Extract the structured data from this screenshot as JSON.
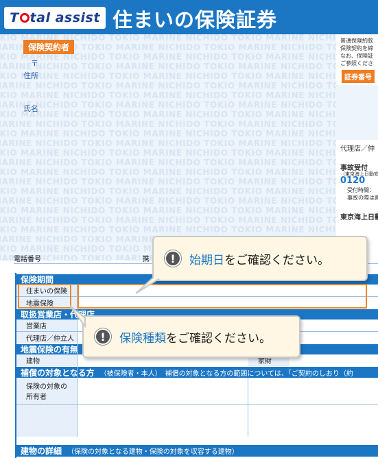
{
  "header": {
    "logo_prefix": "T",
    "logo_suffix": "tal assist",
    "title": "住まいの保険証券"
  },
  "pattern": {
    "text": "TOKIO MARINE NICHIDO TOKIO MARINE NICHIDO TOKIO MARINE NICHIDO TOKIO MARINE NICHIDO"
  },
  "policyholder": {
    "label": "保険契約者",
    "postal_mark": "〒",
    "address_label": "住所",
    "name_label": "氏名"
  },
  "right_column": {
    "line1": "普通保険約款",
    "line2": "保険契約を締",
    "line3": "なお、保険証",
    "line4": "ご参照くださ",
    "policy_no_label": "証券番号",
    "agent_label": "代理店／仲",
    "accident_label": "事故受付",
    "accident_note": "（東京海上日動安",
    "free_dial": "0120",
    "hours": "受付時間：",
    "note2": "事故の際は直",
    "company": "東京海上日動"
  },
  "phone_row": {
    "phone_label": "電話番号",
    "mobile_label": "携"
  },
  "sections": {
    "period": "保険期間",
    "period_row1": "住まいの保険",
    "period_row2": "地震保険",
    "agency": "取扱営業店・代理店",
    "agency_row1": "営業店",
    "agency_row2": "代理店／仲立人",
    "eq": "地震保険の有無",
    "eq_building": "建物",
    "eq_contents": "家財",
    "coverage": "補償の対象となる方",
    "coverage_sub": "（被保険者・本人）　補償の対象となる方の範囲については、「ご契約のしおり（約",
    "coverage_owner1": "保険の対象の",
    "coverage_owner2": "所有者",
    "building": "建物の詳細",
    "building_sub": "（保険の対象となる建物・保険の対象を収容する建物）"
  },
  "callout_1": {
    "highlight": "始期日",
    "rest": "をご確認ください。",
    "icon": "exclamation-icon"
  },
  "callout_2": {
    "highlight": "保険種類",
    "rest": "をご確認ください。",
    "icon": "exclamation-icon"
  },
  "colors": {
    "brand_blue": "#1b76c4",
    "accent_orange": "#ef7d21",
    "callout_bg": "#fff7e3"
  }
}
